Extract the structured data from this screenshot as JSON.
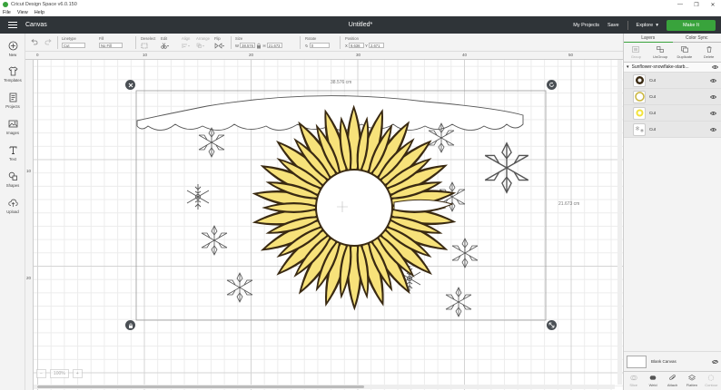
{
  "titlebar": {
    "title": "Cricut Design Space  v6.0.150",
    "min": "—",
    "max": "❐",
    "close": "✕"
  },
  "menu": [
    "File",
    "View",
    "Help"
  ],
  "header": {
    "canvas_label": "Canvas",
    "doc_title": "Untitled*",
    "my_projects": "My Projects",
    "save": "Save",
    "machine": "Explore",
    "make_it": "Make It"
  },
  "toolbar": {
    "linetype_label": "Linetype",
    "linetype_value": "Cut",
    "fill_label": "Fill",
    "fill_value": "No Fill",
    "deselect_label": "Deselect",
    "edit_label": "Edit",
    "align_label": "Align",
    "arrange_label": "Arrange",
    "flip_label": "Flip",
    "size_label": "Size",
    "size_w_prefix": "W",
    "size_w": "38.576",
    "size_h_prefix": "H",
    "size_h": "21.673",
    "rotate_label": "Rotate",
    "rotate_value": "0",
    "position_label": "Position",
    "pos_x_prefix": "X",
    "pos_x": "9.636",
    "pos_y_prefix": "Y",
    "pos_y": "2.671"
  },
  "sidebar": [
    {
      "label": "New",
      "icon": "plus-icon"
    },
    {
      "label": "Templates",
      "icon": "shirt-icon"
    },
    {
      "label": "Projects",
      "icon": "projects-icon"
    },
    {
      "label": "Images",
      "icon": "images-icon"
    },
    {
      "label": "Text",
      "icon": "text-icon"
    },
    {
      "label": "Shapes",
      "icon": "shapes-icon"
    },
    {
      "label": "Upload",
      "icon": "upload-icon"
    }
  ],
  "rulers": {
    "top": [
      "0",
      "10",
      "20",
      "30",
      "40",
      "50"
    ],
    "left": [
      "10",
      "20"
    ]
  },
  "canvas": {
    "width_label": "38.576 cm",
    "height_label": "21.673 cm",
    "zoom": "100%"
  },
  "layers_panel": {
    "tabs": [
      "Layers",
      "Color Sync"
    ],
    "actions": [
      "Group",
      "UnGroup",
      "Duplicate",
      "Delete"
    ],
    "group_name": "Sunflower-snowflake-starb...",
    "layers": [
      {
        "name": "Cut",
        "color": "#3a2a12"
      },
      {
        "name": "Cut",
        "color": "#e8d35a"
      },
      {
        "name": "Cut",
        "color": "#f2e23a"
      },
      {
        "name": "Cut",
        "color": "#888888"
      }
    ],
    "blank_canvas": "Blank Canvas",
    "bottom_actions": [
      "Slice",
      "Weld",
      "Attach",
      "Flatten",
      "Contour"
    ]
  },
  "colors": {
    "accent": "#39a33c",
    "header_bg": "#2f3438",
    "petal": "#f7e27a",
    "petal_outline": "#3a2a12"
  }
}
